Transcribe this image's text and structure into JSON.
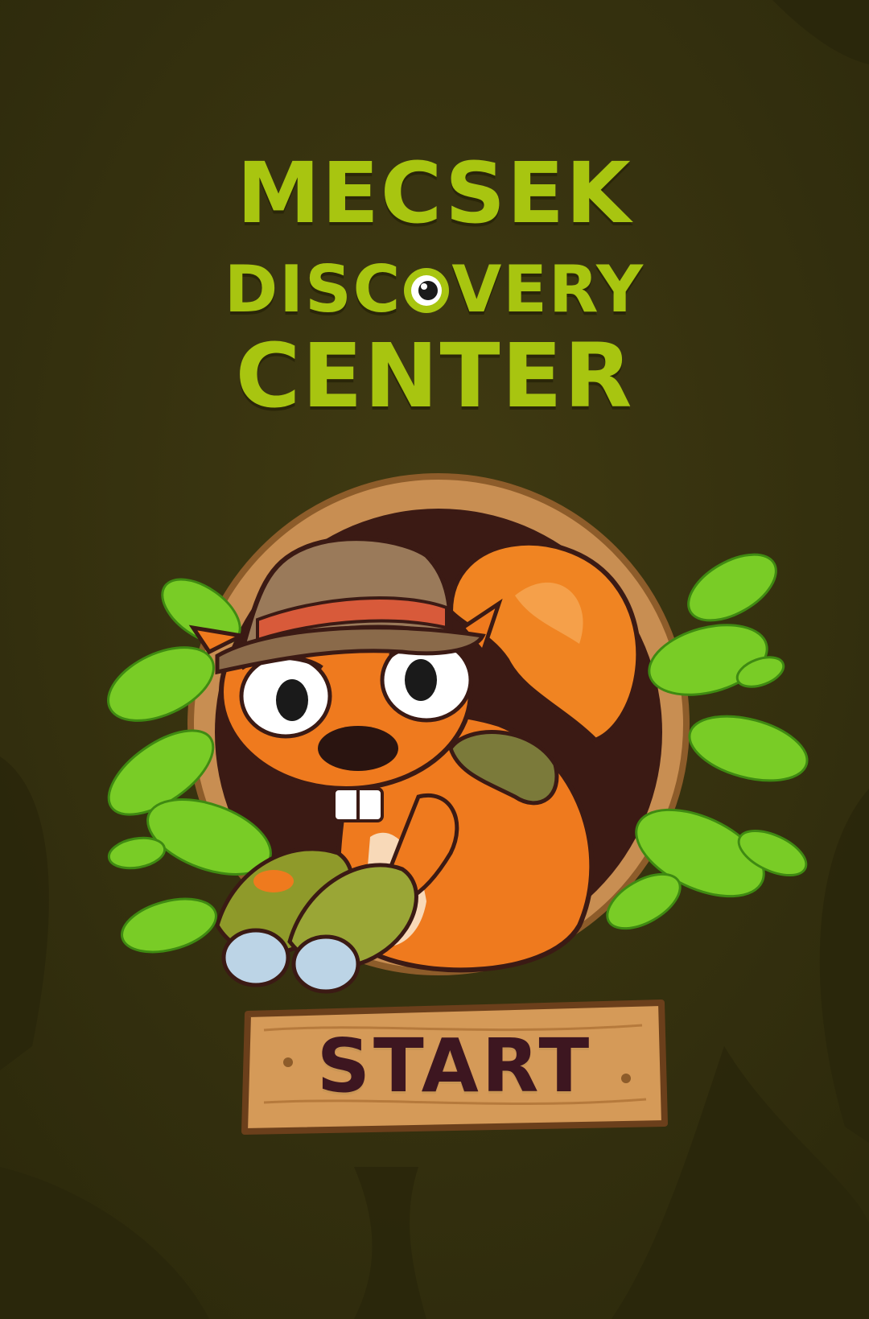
{
  "title": {
    "line1": "MECSEK",
    "line2_before_icon": "DISC",
    "line2_after_icon": "VERY",
    "line3": "CENTER"
  },
  "start_button": {
    "label": "START"
  },
  "icons": {
    "title_o": "eye-icon",
    "mascot": "squirrel-explorer-icon"
  },
  "colors": {
    "background": "#3a3510",
    "title": "#a8c510",
    "start_text": "#3d1620",
    "wood": "#d8a56a",
    "squirrel": "#ef7a1e",
    "leaf": "#7fcf2a"
  }
}
